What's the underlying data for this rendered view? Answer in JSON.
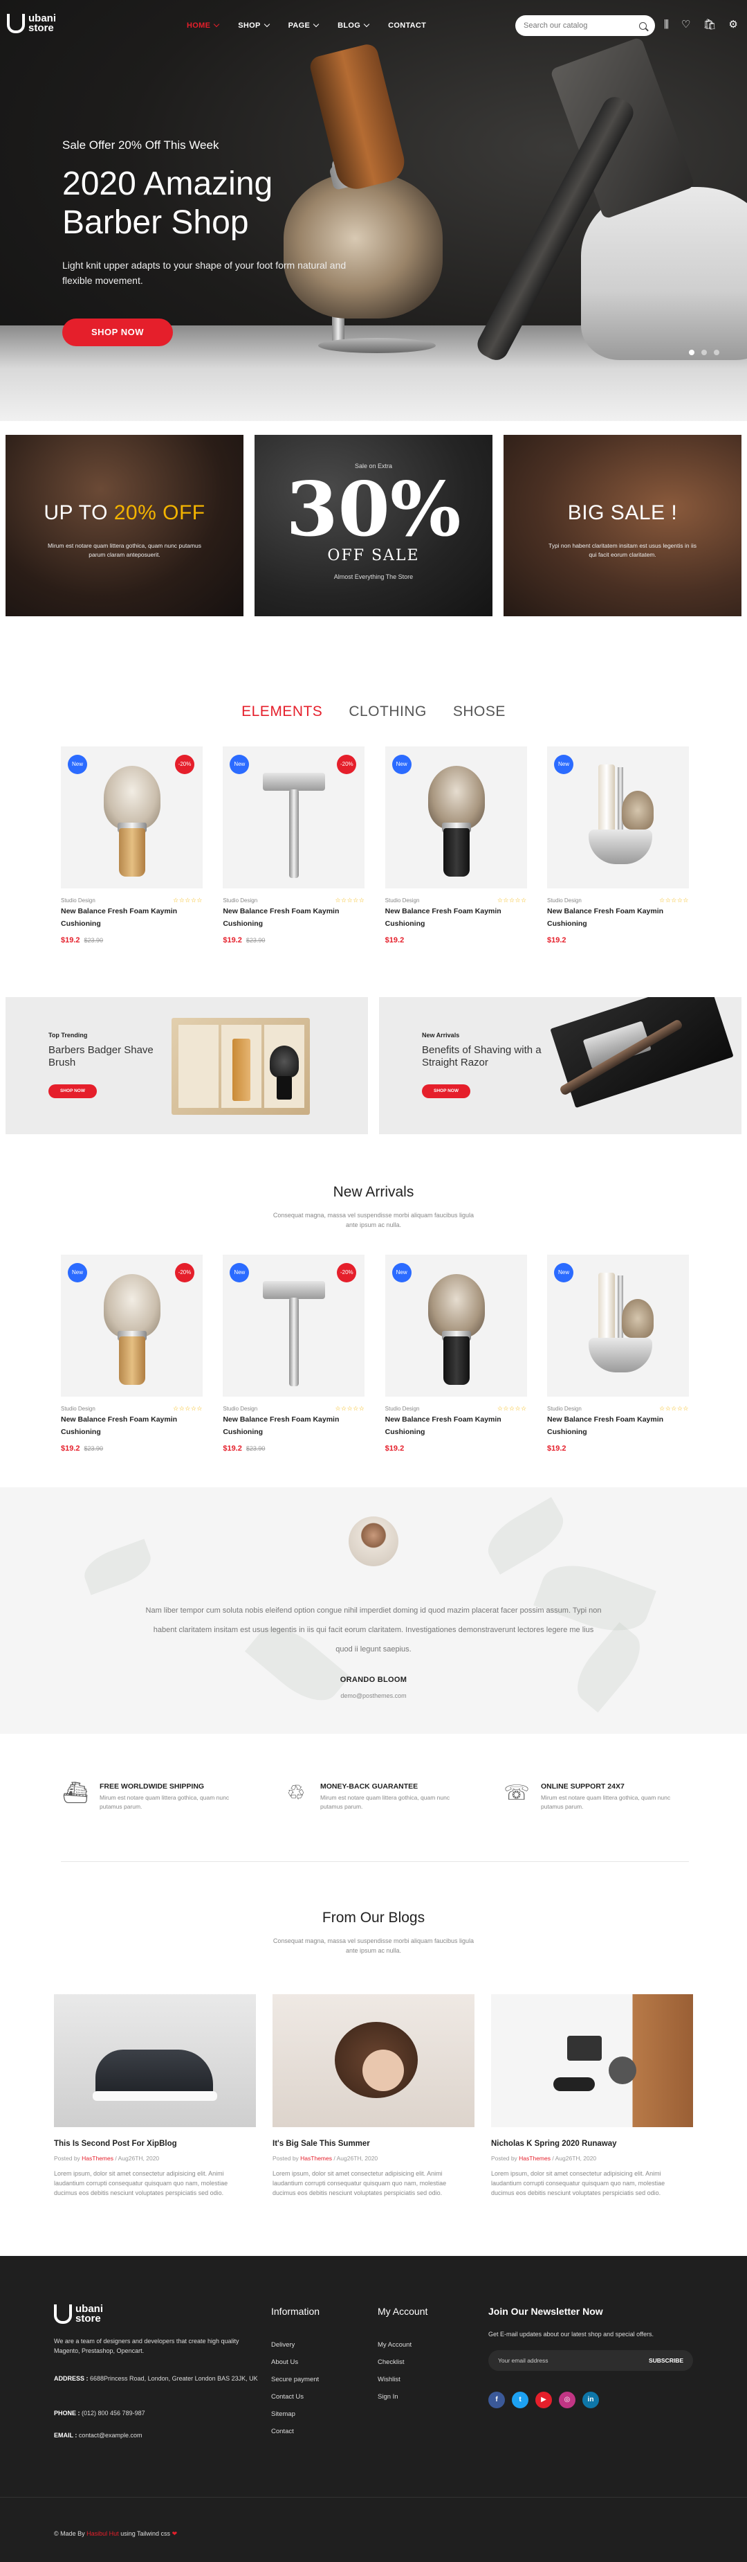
{
  "header": {
    "logo_line1": "ubani",
    "logo_line2": "store",
    "nav": [
      {
        "label": "HOME",
        "active": true,
        "caret": true
      },
      {
        "label": "SHOP",
        "caret": true
      },
      {
        "label": "PAGE",
        "caret": true
      },
      {
        "label": "BLOG",
        "caret": true
      },
      {
        "label": "CONTACT",
        "caret": false
      }
    ],
    "search_placeholder": "Search our catalog",
    "icons": [
      {
        "name": "compare-icon",
        "glyph": "⫼",
        "badge": "0"
      },
      {
        "name": "wishlist-icon",
        "glyph": "♡",
        "badge": "0"
      },
      {
        "name": "cart-icon",
        "glyph": "🛍",
        "badge": "0"
      },
      {
        "name": "settings-icon",
        "glyph": "⚙",
        "badge": ""
      }
    ]
  },
  "hero": {
    "subtitle": "Sale Offer 20% Off This Week",
    "title": "2020 Amazing Barber Shop",
    "description": "Light knit upper adapts to your shape of your foot form natural and flexible movement.",
    "button": "SHOP NOW"
  },
  "promos": [
    {
      "title_a": "UP TO ",
      "title_b": "20% OFF",
      "desc": "Mirum est notare quam littera gothica, quam nunc putamus parum claram anteposuerit."
    },
    {
      "small": "Sale on Extra",
      "big": "30%",
      "off": "OFF SALE",
      "foot": "Almost Everything The Store"
    },
    {
      "title": "BIG SALE !",
      "desc": "Typi non habent claritatem insitam est usus legentis in iis qui facit eorum claritatem."
    }
  ],
  "tabs": [
    "ELEMENTS",
    "CLOTHING",
    "SHOSE"
  ],
  "products": [
    {
      "new": "New",
      "sale": "-20%",
      "cat": "Studio Design",
      "name": "New Balance Fresh Foam Kaymin Cushioning",
      "price": "$19.2",
      "old": "$23.90",
      "kind": "brush-light"
    },
    {
      "new": "New",
      "sale": "-20%",
      "cat": "Studio Design",
      "name": "New Balance Fresh Foam Kaymin Cushioning",
      "price": "$19.2",
      "old": "$23.90",
      "kind": "razor"
    },
    {
      "new": "New",
      "sale": "",
      "cat": "Studio Design",
      "name": "New Balance Fresh Foam Kaymin Cushioning",
      "price": "$19.2",
      "old": "",
      "kind": "brush-dark"
    },
    {
      "new": "New",
      "sale": "",
      "cat": "Studio Design",
      "name": "New Balance Fresh Foam Kaymin Cushioning",
      "price": "$19.2",
      "old": "",
      "kind": "stand"
    }
  ],
  "stars": "☆☆☆☆☆",
  "features": [
    {
      "small": "Top Trending",
      "title": "Barbers Badger Shave Brush",
      "button": "SHOP NOW"
    },
    {
      "small": "New Arrivals",
      "title": "Benefits of Shaving with a Straight Razor",
      "button": "SHOP NOW"
    }
  ],
  "new_arrivals": {
    "title": "New Arrivals",
    "desc": "Consequat magna, massa vel suspendisse morbi aliquam faucibus ligula ante ipsum ac nulla."
  },
  "testimonial": {
    "text": "Nam liber tempor cum soluta nobis eleifend option congue nihil imperdiet doming id quod mazim placerat facer possim assum. Typi non habent claritatem insitam est usus legentis in iis qui facit eorum claritatem. Investigationes demonstraverunt lectores legere me lius quod ii legunt saepius.",
    "name": "ORANDO BLOOM",
    "email": "demo@posthemes.com"
  },
  "services": [
    {
      "icon": "ship-icon",
      "glyph": "⛴",
      "title": "FREE WORLDWIDE SHIPPING",
      "desc": "Mirum est notare quam littera gothica, quam nunc putamus parum."
    },
    {
      "icon": "piggy-bank-icon",
      "glyph": "♲",
      "title": "MONEY-BACK GUARANTEE",
      "desc": "Mirum est notare quam littera gothica, quam nunc putamus parum."
    },
    {
      "icon": "support-icon",
      "glyph": "☏",
      "title": "ONLINE SUPPORT 24X7",
      "desc": "Mirum est notare quam littera gothica, quam nunc putamus parum."
    }
  ],
  "blog_section": {
    "title": "From Our Blogs",
    "desc": "Consequat magna, massa vel suspendisse morbi aliquam faucibus ligula ante ipsum ac nulla."
  },
  "blogs": [
    {
      "title": "This Is Second Post For XipBlog",
      "posted": "Posted by ",
      "author": "HasThemes",
      "date": " / Aug26TH, 2020",
      "text": "Lorem ipsum, dolor sit amet consectetur adipisicing elit. Animi laudantium corrupti consequatur quisquam quo nam, molestiae ducimus eos debitis nesciunt voluptates perspiciatis sed odio."
    },
    {
      "title": "It's Big Sale This Summer",
      "posted": "Posted by ",
      "author": "HasThemes",
      "date": " / Aug26TH, 2020",
      "text": "Lorem ipsum, dolor sit amet consectetur adipisicing elit. Animi laudantium corrupti consequatur quisquam quo nam, molestiae ducimus eos debitis nesciunt voluptates perspiciatis sed odio."
    },
    {
      "title": "Nicholas K Spring 2020 Runaway",
      "posted": "Posted by ",
      "author": "HasThemes",
      "date": " / Aug26TH, 2020",
      "text": "Lorem ipsum, dolor sit amet consectetur adipisicing elit. Animi laudantium corrupti consequatur quisquam quo nam, molestiae ducimus eos debitis nesciunt voluptates perspiciatis sed odio."
    }
  ],
  "footer": {
    "about": "We are a team of designers and developers that create high quality Magento, Prestashop, Opencart.",
    "address_label": "ADDRESS :",
    "address": " 6688Princess Road, London, Greater London BAS 23JK, UK",
    "phone_label": "PHONE :",
    "phone": " (012) 800 456 789-987",
    "email_label": "EMAIL :",
    "email": " contact@example.com",
    "info_title": "Information",
    "info_links": [
      "Delivery",
      "About Us",
      "Secure payment",
      "Contact Us",
      "Sitemap",
      "Contact"
    ],
    "account_title": "My Account",
    "account_links": [
      "My Account",
      "Checklist",
      "Wishlist",
      "Sign In"
    ],
    "newsletter_title": "Join Our Newsletter Now",
    "newsletter_desc": "Get E-mail updates about our latest shop and special offers.",
    "newsletter_placeholder": "Your email address",
    "subscribe": "SUBSCRIBE",
    "socials": [
      {
        "name": "facebook-icon",
        "glyph": "f",
        "color": "#3b5998"
      },
      {
        "name": "twitter-icon",
        "glyph": "t",
        "color": "#1da1f2"
      },
      {
        "name": "youtube-icon",
        "glyph": "▶",
        "color": "#e51f2b"
      },
      {
        "name": "instagram-icon",
        "glyph": "◎",
        "color": "#c13584"
      },
      {
        "name": "linkedin-icon",
        "glyph": "in",
        "color": "#0e76a8"
      }
    ],
    "copy_a": "© Made By ",
    "copy_b": "Hasibul Hut",
    "copy_c": " using Tailwind css ",
    "heart": "❤"
  },
  "colors": {
    "accent": "#e51f2b",
    "badge_new": "#2b6bff",
    "footer_bg": "#1f1f1f"
  }
}
